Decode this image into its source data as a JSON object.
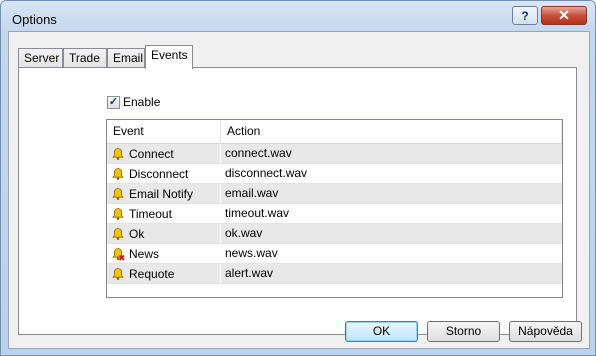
{
  "window": {
    "title": "Options",
    "help_glyph": "?",
    "close_glyph": "✕"
  },
  "tabs": [
    {
      "label": "Server"
    },
    {
      "label": "Trade"
    },
    {
      "label": "Email"
    },
    {
      "label": "Events",
      "active": true
    }
  ],
  "events_panel": {
    "enable_label": "Enable",
    "enable_checked": true,
    "columns": {
      "event": "Event",
      "action": "Action"
    },
    "rows": [
      {
        "event": "Connect",
        "action": "connect.wav",
        "icon": "bell-icon"
      },
      {
        "event": "Disconnect",
        "action": "disconnect.wav",
        "icon": "bell-icon"
      },
      {
        "event": "Email Notify",
        "action": "email.wav",
        "icon": "bell-icon"
      },
      {
        "event": "Timeout",
        "action": "timeout.wav",
        "icon": "bell-icon"
      },
      {
        "event": "Ok",
        "action": "ok.wav",
        "icon": "bell-icon"
      },
      {
        "event": "News",
        "action": "news.wav",
        "icon": "bell-disabled-icon"
      },
      {
        "event": "Requote",
        "action": "alert.wav",
        "icon": "bell-icon"
      }
    ]
  },
  "buttons": {
    "ok": "OK",
    "cancel": "Storno",
    "help": "Nápověda"
  },
  "colors": {
    "bell": "#f2c200",
    "disabled_mark": "#d01010",
    "alt_row": "#e8e8e8"
  }
}
